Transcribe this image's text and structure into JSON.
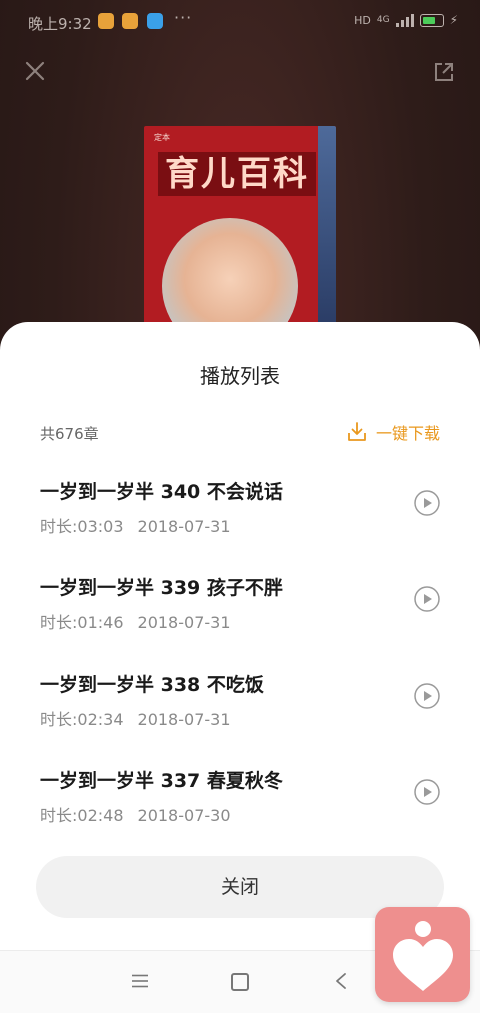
{
  "status_bar": {
    "time": "晚上9:32",
    "dots": "···",
    "network": "HD",
    "signal_label": "4G"
  },
  "cover": {
    "top_text": "定本",
    "title": "育儿百科"
  },
  "sheet": {
    "title": "播放列表",
    "count": "共676章",
    "download_label": "一键下载",
    "close_label": "关闭"
  },
  "tracks": [
    {
      "title": "一岁到一岁半 340 不会说话",
      "duration": "时长:03:03",
      "date": "2018-07-31"
    },
    {
      "title": "一岁到一岁半 339 孩子不胖",
      "duration": "时长:01:46",
      "date": "2018-07-31"
    },
    {
      "title": "一岁到一岁半 338 不吃饭",
      "duration": "时长:02:34",
      "date": "2018-07-31"
    },
    {
      "title": "一岁到一岁半 337 春夏秋冬",
      "duration": "时长:02:48",
      "date": "2018-07-30"
    }
  ],
  "colors": {
    "accent": "#e9981e",
    "widget": "#ee8f8e"
  },
  "icons": [
    "close-icon",
    "share-icon",
    "download-icon",
    "play-icon",
    "menu-icon",
    "home-icon",
    "back-icon",
    "heart-icon"
  ]
}
